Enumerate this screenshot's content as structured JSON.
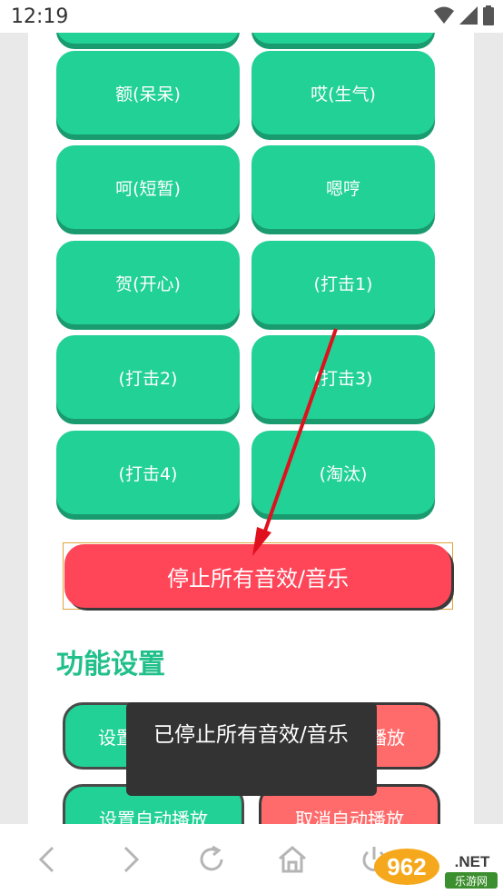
{
  "status_bar": {
    "time": "12:19"
  },
  "sound_buttons": [
    {
      "label": "额(呆呆)"
    },
    {
      "label": "哎(生气)"
    },
    {
      "label": "呵(短暂)"
    },
    {
      "label": "嗯哼"
    },
    {
      "label": "贺(开心)"
    },
    {
      "label": "(打击1)"
    },
    {
      "label": "(打击2)"
    },
    {
      "label": "(打击3)"
    },
    {
      "label": "(打击4)"
    },
    {
      "label": "(淘汰)"
    }
  ],
  "stop_button": {
    "label": "停止所有音效/音乐"
  },
  "settings": {
    "title": "功能设置",
    "row1_left": "设置",
    "row1_right": "播放",
    "row2_left": "设置自动播放",
    "row2_right": "取消自动播放"
  },
  "toast": {
    "text": "已停止所有音效/音乐"
  },
  "watermark": {
    "brand": "962",
    "suffix": ".NET",
    "sub": "乐游网"
  },
  "colors": {
    "green": "#21d196",
    "red": "#ff4558",
    "title_green": "#21c08a",
    "toast_bg": "#333333"
  },
  "nav_icons": [
    "back-icon",
    "forward-icon",
    "refresh-icon",
    "home-icon",
    "power-icon"
  ]
}
